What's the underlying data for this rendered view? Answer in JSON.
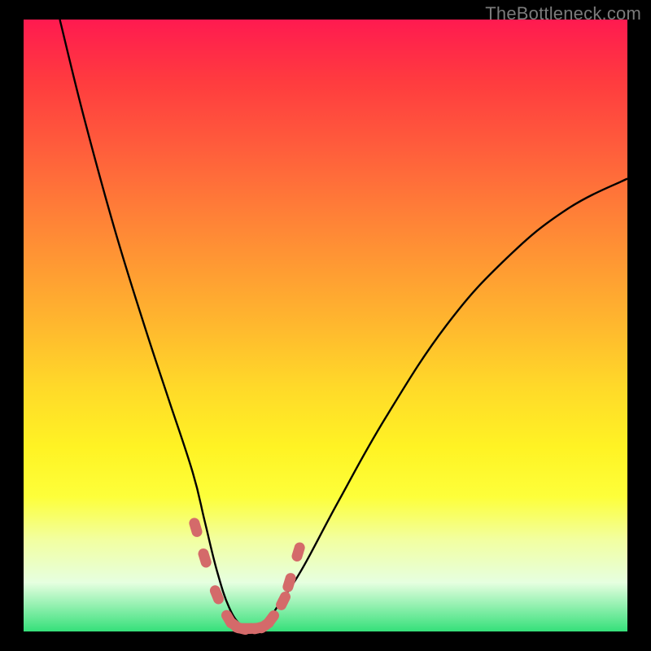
{
  "watermark": "TheBottleneck.com",
  "colors": {
    "page_bg": "#000000",
    "watermark": "#7b7b7b",
    "curve": "#000000",
    "marker": "#d46a6a",
    "gradient_stops": [
      "#ff1a50",
      "#ff3b3f",
      "#ff5a3c",
      "#ff7a38",
      "#ff9933",
      "#ffb82e",
      "#ffd929",
      "#fff324",
      "#fdff3a",
      "#f2ffa0",
      "#e6ffe0",
      "#35e07a"
    ]
  },
  "chart_data": {
    "type": "line",
    "title": "",
    "xlabel": "",
    "ylabel": "",
    "xlim": [
      0,
      100
    ],
    "ylim": [
      0,
      100
    ],
    "series": [
      {
        "name": "bottleneck-curve",
        "x": [
          6,
          10,
          15,
          20,
          24,
          28,
          30,
          32,
          34,
          36,
          38,
          40,
          42,
          46,
          52,
          60,
          70,
          80,
          90,
          100
        ],
        "y": [
          100,
          84,
          66,
          50,
          38,
          26,
          18,
          10,
          4,
          1,
          0,
          1,
          4,
          10,
          21,
          35,
          50,
          61,
          69,
          74
        ]
      }
    ],
    "markers": {
      "name": "highlight-band",
      "x": [
        28.5,
        30,
        32,
        34,
        35,
        36,
        37,
        38,
        39,
        40,
        41,
        43,
        44,
        45.5
      ],
      "y": [
        17,
        12,
        6,
        2,
        1,
        0.5,
        0.5,
        0.5,
        0.6,
        1,
        2,
        5,
        8,
        13
      ]
    }
  }
}
